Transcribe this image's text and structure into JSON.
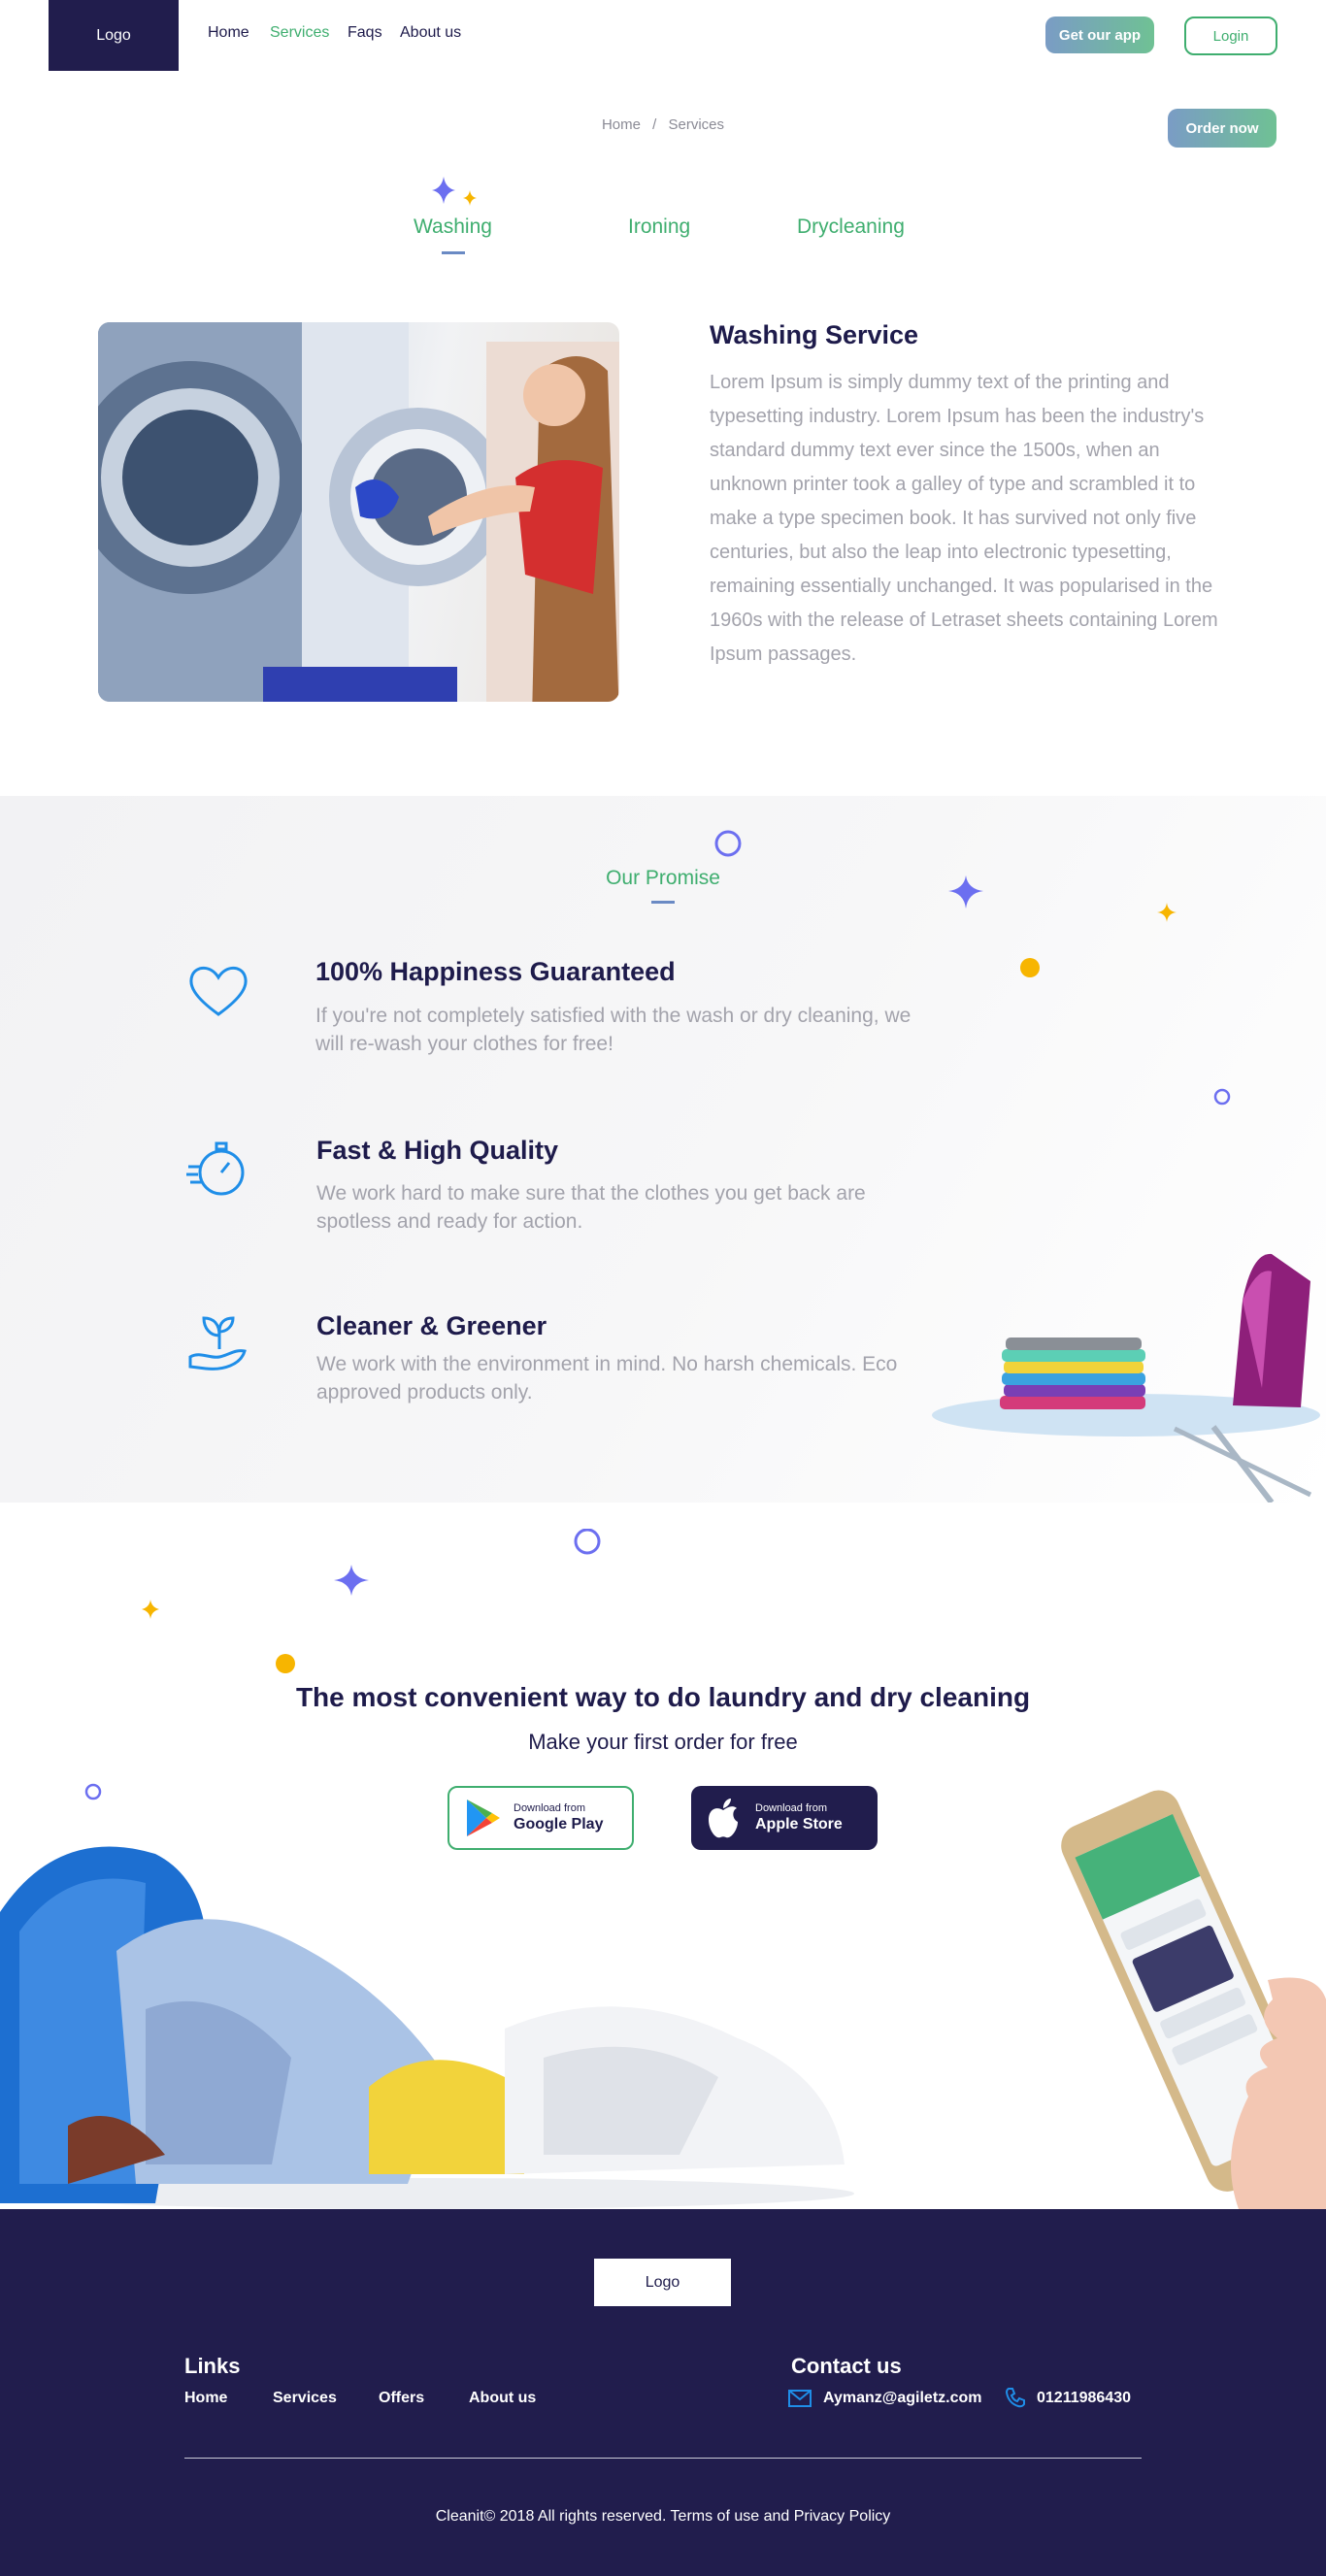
{
  "header": {
    "logo": "Logo",
    "nav": [
      "Home",
      "Services",
      "Faqs",
      "About us"
    ],
    "active_nav": "Services",
    "get_app": "Get our app",
    "login": "Login"
  },
  "breadcrumb": {
    "home": "Home",
    "separator": "/",
    "current": "Services"
  },
  "order_now": "Order now",
  "service_tabs": [
    "Washing",
    "Ironing",
    "Drycleaning"
  ],
  "washing": {
    "title": "Washing Service",
    "body": "Lorem Ipsum is simply dummy text of the printing and typesetting industry. Lorem Ipsum has been the industry's standard dummy text ever since the 1500s, when an unknown printer took a galley of type and scrambled it to make a type specimen book. It has survived not only five centuries, but also the leap into electronic typesetting, remaining essentially unchanged. It was popularised in the 1960s with the release of Letraset sheets containing Lorem Ipsum passages."
  },
  "promise": {
    "title": "Our Promise",
    "features": [
      {
        "icon": "heart-icon",
        "title": "100% Happiness Guaranteed",
        "body": "If you're not completely satisfied with the wash or dry cleaning, we will re-wash your clothes for free!"
      },
      {
        "icon": "stopwatch-icon",
        "title": "Fast & High Quality",
        "body": "We work hard to make sure that the clothes you get back are spotless and ready for action."
      },
      {
        "icon": "plant-hand-icon",
        "title": "Cleaner & Greener",
        "body": "We work with the environment in mind. No harsh chemicals. Eco approved products only."
      }
    ]
  },
  "cta": {
    "title": "The most convenient way to do laundry and dry cleaning",
    "subtitle": "Make your first order for free",
    "google": {
      "small": "Download from",
      "big": "Google Play"
    },
    "apple": {
      "small": "Download from",
      "big": "Apple Store"
    }
  },
  "footer": {
    "logo": "Logo",
    "links_title": "Links",
    "links": [
      "Home",
      "Services",
      "Offers",
      "About us"
    ],
    "contact_title": "Contact us",
    "email": "Aymanz@agiletz.com",
    "phone": "01211986430",
    "copyright": "Cleanit© 2018 All rights reserved. Terms of use and Privacy Policy"
  },
  "colors": {
    "navy": "#211d4d",
    "green": "#3fae6f",
    "purple": "#6c6ff0",
    "yellow": "#f7b500",
    "blue_icon": "#1f8ee8"
  }
}
